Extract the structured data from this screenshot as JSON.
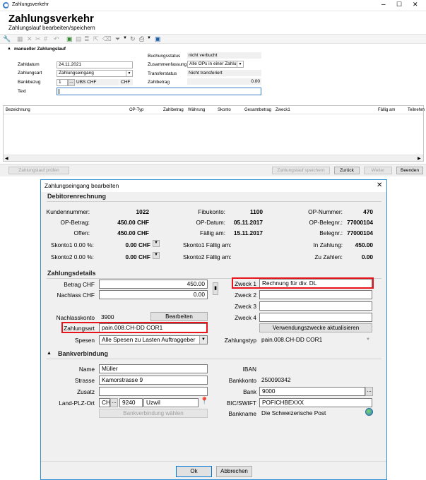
{
  "main": {
    "window_title": "Zahlungsverkehr",
    "title": "Zahlungsverkehr",
    "subtitle": "Zahlungslauf bearbeiten/speichern",
    "section_label": "manueller Zahlungslauf",
    "fields": {
      "zahldatum_label": "Zahldatum",
      "zahldatum_value": "24.11.2021",
      "zahlungsart_label": "Zahlungsart",
      "zahlungsart_value": "Zahlungseingang",
      "bankbezug_label": "Bankbezug",
      "bankbezug_nr": "1",
      "bankbezug_bank": "UBS CHF",
      "bankbezug_currency": "CHF",
      "text_label": "Text",
      "text_value": "",
      "buchungsstatus_label": "Buchungsstatus",
      "buchungsstatus_value": "nicht verbucht",
      "zusammenfassung_label": "Zusammenfassung",
      "zusammenfassung_value": "Alle OPs in einer Zahlung",
      "transferstatus_label": "Transferstatus",
      "transferstatus_value": "Nicht transferiert",
      "zahlbetrag_label": "Zahlbetrag",
      "zahlbetrag_value": "0.00"
    },
    "columns": [
      "Bezeichnung",
      "OP-Typ",
      "Zahlbetrag",
      "Währung",
      "Skonto",
      "Gesamtbetrag",
      "Zweck1",
      "Fällig am",
      "Teilnehm"
    ],
    "buttons": {
      "zahlungslauf_pruefen": "Zahlungslauf prüfen",
      "zahlungslauf_speichern": "Zahlungslauf speichern",
      "zurueck": "Zurück",
      "weiter": "Weiter",
      "beenden": "Beenden"
    }
  },
  "dialog": {
    "title": "Zahlungseingang bearbeiten",
    "debitor_section": "Debitorenrechnung",
    "kundennummer_label": "Kundennummer:",
    "kundennummer_value": "1022",
    "opbetrag_label": "OP-Betrag:",
    "opbetrag_value": "450.00 CHF",
    "offen_label": "Offen:",
    "offen_value": "450.00 CHF",
    "skonto1_label": "Skonto1 0.00 %:",
    "skonto1_value": "0.00 CHF",
    "skonto2_label": "Skonto2 0.00 %:",
    "skonto2_value": "0.00 CHF",
    "fibukonto_label": "Fibukonto:",
    "fibukonto_value": "1100",
    "opdatum_label": "OP-Datum:",
    "opdatum_value": "05.11.2017",
    "faellig_label": "Fällig am:",
    "faellig_value": "15.11.2017",
    "skonto1_faellig_label": "Skonto1 Fällig am:",
    "skonto2_faellig_label": "Skonto2 Fällig am:",
    "opnummer_label": "OP-Nummer:",
    "opnummer_value": "470",
    "opbelegnr_label": "OP-Belegnr.:",
    "opbelegnr_value": "77000104",
    "belegnr_label": "Belegnr.:",
    "belegnr_value": "77000104",
    "inzahlung_label": "In Zahlung:",
    "inzahlung_value": "450.00",
    "zuzahlen_label": "Zu Zahlen:",
    "zuzahlen_value": "0.00",
    "zahlungsdetails_section": "Zahlungsdetails",
    "betrag_label": "Betrag CHF",
    "betrag_value": "450.00",
    "nachlass_label": "Nachlass CHF",
    "nachlass_value": "0.00",
    "nachlasskonto_label": "Nachlasskonto",
    "nachlasskonto_value": "3900",
    "bearbeiten_button": "Bearbeiten",
    "zahlungsart_label": "Zahlungsart",
    "zahlungsart_value": "pain.008.CH-DD COR1",
    "spesen_label": "Spesen",
    "spesen_value": "Alle Spesen zu Lasten Auftraggeber",
    "zweck1_label": "Zweck 1",
    "zweck1_value": "Rechnung für div. DL",
    "zweck2_label": "Zweck 2",
    "zweck3_label": "Zweck 3",
    "zweck4_label": "Zweck 4",
    "verwendungszwecke_button": "Verwendungszwecke aktualisieren",
    "zahlungstyp_label": "Zahlungstyp",
    "zahlungstyp_value": "pain.008.CH-DD COR1",
    "bank_section": "Bankverbindung",
    "name_label": "Name",
    "name_value": "Müller",
    "strasse_label": "Strasse",
    "strasse_value": "Kamorstrasse 9",
    "zusatz_label": "Zusatz",
    "zusatz_value": "",
    "lpo_label": "Land-PLZ-Ort",
    "land_value": "CH",
    "plz_value": "9240",
    "ort_value": "Uzwil",
    "bankverbindung_waehlen": "Bankverbindung wählen",
    "iban_label": "IBAN",
    "iban_value": "",
    "bankkonto_label": "Bankkonto",
    "bankkonto_value": "250090342",
    "bank_label": "Bank",
    "bank_value": "9000",
    "bic_label": "BIC/SWIFT",
    "bic_value": "POFICHBEXXX",
    "bankname_label": "Bankname",
    "bankname_value": "Die Schweizerische Post",
    "ok_button": "Ok",
    "abbrechen_button": "Abbrechen"
  },
  "colors": {
    "highlight": "#e8141b",
    "dialog_border": "#2f8fd6"
  }
}
